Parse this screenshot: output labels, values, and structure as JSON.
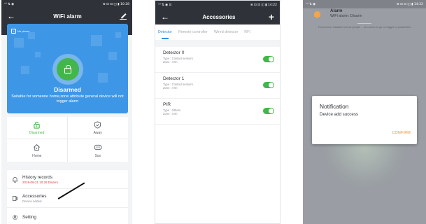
{
  "phone1": {
    "status_left": "ᵐˡ ⇅ ◉",
    "status_right": "⊗ ⊡ ⊡ ◫ ▮ 10:28",
    "title": "WiFi alarm",
    "hero": {
      "phone_label": "No phone",
      "state_title": "Disarmed",
      "state_desc": "Suitable for someone home,zone attribute general device will not trigger alarm"
    },
    "modes": [
      {
        "label": "Disarmed",
        "icon": "unlock-icon",
        "active": true
      },
      {
        "label": "Away",
        "icon": "shield-icon",
        "active": false
      },
      {
        "label": "Home",
        "icon": "home-icon",
        "active": false
      },
      {
        "label": "Sos",
        "icon": "sos-icon",
        "active": false
      }
    ],
    "menu": [
      {
        "title": "History records",
        "sub": "2019-09-21 10:28  Disarm",
        "icon": "bell-icon"
      },
      {
        "title": "Accessories",
        "sub": "Device added",
        "icon": "accessory-icon"
      },
      {
        "title": "Setting",
        "sub": "",
        "icon": "gear-icon"
      }
    ],
    "colors": {
      "accent": "#43b649",
      "hero": "#3e97e6",
      "header": "#2f3339",
      "history_sub": "#e23b3b"
    }
  },
  "phone2": {
    "status_left": "ᵐˡ ⇅ ◉ ⊡",
    "status_right": "⊗ ⊡ ⊡ ◫ ▮ 14:22",
    "title": "Accessories",
    "tabs": [
      {
        "label": "Detector",
        "active": true
      },
      {
        "label": "Remote controller",
        "active": false
      },
      {
        "label": "Wired detector",
        "active": false
      },
      {
        "label": "RFI",
        "active": false
      }
    ],
    "devices": [
      {
        "name": "Detector 0",
        "type": "Type : Contact sensors",
        "zone": "Zone : Arm",
        "enabled": true
      },
      {
        "name": "Detector 1",
        "type": "Type : Contact sensors",
        "zone": "Zone : Arm",
        "enabled": true
      },
      {
        "name": "PIR",
        "type": "Type : Others",
        "zone": "Zone : Arm",
        "enabled": true
      }
    ],
    "colors": {
      "tab_active": "#2d8fe4",
      "toggle_on": "#43b649"
    }
  },
  "phone3": {
    "status_left": "ᵐˡ ⇅ ◉",
    "status_right": "⊗ ⊡ ⊡ ◫ ▮ 14:22",
    "alarm_title": "Alarm",
    "alarm_sub": "WiFi alarm:  Disarm",
    "background_note": "Fixed ones: Installed normal people ... arm when to go no trigger to protect this",
    "dialog": {
      "title": "Notification",
      "message": "Device add success",
      "confirm_label": "CONFIRM"
    },
    "colors": {
      "confirm": "#f0902b",
      "bell": "#f2a64c"
    }
  }
}
